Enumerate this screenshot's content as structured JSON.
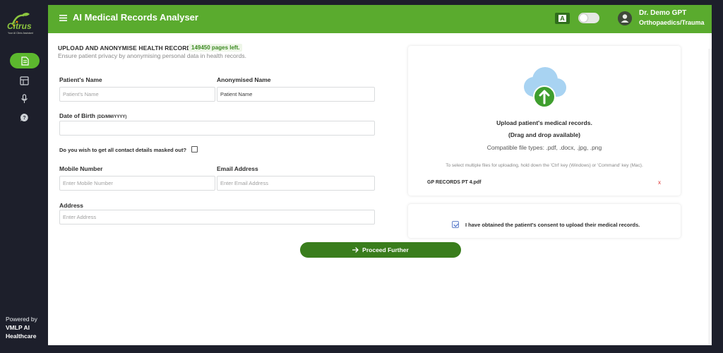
{
  "brand": {
    "logo_text": "Citrus",
    "logo_subtitle": "Your AI Clinic Assistant",
    "powered_by": "Powered by",
    "company": "VMLP AI Healthcare"
  },
  "header": {
    "title": "AI Medical Records Analyser",
    "lang_label": "A",
    "user_name": "Dr. Demo GPT",
    "user_role": "Orthopaedics/Trauma"
  },
  "section": {
    "title": "UPLOAD AND ANONYMISE HEALTH RECORDS",
    "pages_left": "149450 pages left.",
    "subtitle": "Ensure patient privacy by anonymising personal data in health records."
  },
  "form": {
    "patient_name_label": "Patient's Name",
    "patient_name_placeholder": "Patient's Name",
    "anon_name_label": "Anonymised Name",
    "anon_name_value": "Patient Name",
    "dob_label": "Date of Birth",
    "dob_format": "(DD/MM/YYYY)",
    "mask_question": "Do you wish to get all contact details masked out?",
    "mobile_label": "Mobile Number",
    "mobile_placeholder": "Enter Mobile Number",
    "email_label": "Email Address",
    "email_placeholder": "Enter Email Address",
    "address_label": "Address",
    "address_placeholder": "Enter Address"
  },
  "upload": {
    "title": "Upload patient's medical records.",
    "drag_text": "(Drag and drop available)",
    "types": "Compatible file types: .pdf, .docx, .jpg, .png",
    "hint": "To select multiple files for uploading, hold down the 'Ctrl' key (Windows) or 'Command' key (Mac).",
    "file_name": "GP RECORDS PT 4.pdf",
    "remove": "x"
  },
  "consent": {
    "text": "I have obtained the patient's consent to upload their medical records."
  },
  "actions": {
    "proceed": "Proceed Further"
  },
  "colors": {
    "header_green": "#5aab2e",
    "button_green": "#397d1c",
    "sidebar_bg": "#1d1f2b"
  }
}
